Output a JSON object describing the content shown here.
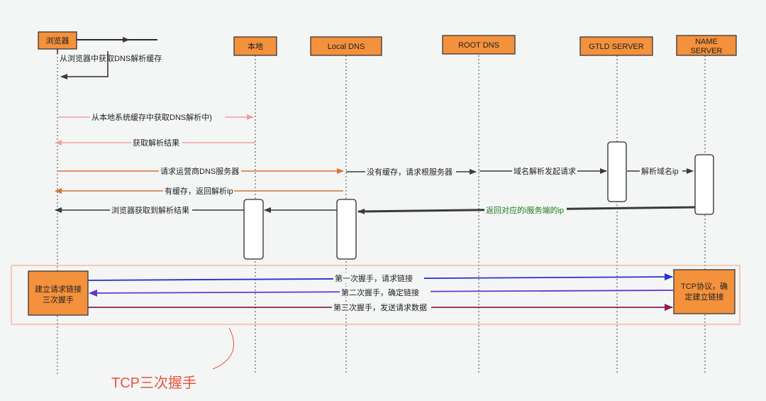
{
  "actors": {
    "browser": "浏览器",
    "local": "本地",
    "local_dns": "Local DNS",
    "root_dns": "ROOT DNS",
    "gtld": "GTLD SERVER",
    "name_server": [
      "NAME",
      "SERVER"
    ]
  },
  "messages": {
    "m0": "从浏览器中获取DNS解析缓存",
    "m1": "从本地系统缓存中获取DNS解析中)",
    "m2": "获取解析结果",
    "m3": "请求运营商DNS服务器",
    "m4": "没有缓存，请求根服务器",
    "m5": "域名解析发起请求",
    "m6": "解析域名ip",
    "m7": "有缓存，返回解析ip",
    "m8": "返回对应的i服务端的ip",
    "m9": "浏览器获取到解析结果"
  },
  "handshake": {
    "left_box": [
      "建立请求链接",
      "三次握手"
    ],
    "right_box": [
      "TCP协议，确",
      "定建立链接"
    ],
    "step1": "第一次握手，请求链接",
    "step2": "第二次握手，确定链接",
    "step3": "第三次握手，发送请求数据"
  },
  "annotation": "TCP三次握手",
  "colors": {
    "actor_fill": "#f4913d",
    "pink": "#f0a0a0",
    "orange": "#d4753a",
    "dark": "#3a3a3a",
    "green_text": "#1d7a1d",
    "blue": "#2233cc",
    "purple": "#6a35c8",
    "maroon": "#8a1f50",
    "annotation_red": "#e8553f"
  }
}
